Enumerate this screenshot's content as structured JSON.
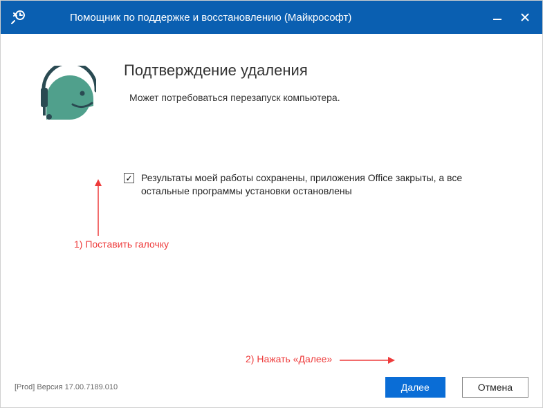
{
  "window": {
    "title": "Помощник по поддержке и восстановлению (Майкрософт)"
  },
  "heading": "Подтверждение удаления",
  "subheading": "Может потребоваться перезапуск компьютера.",
  "checkbox": {
    "checked": true,
    "label": "Результаты моей работы сохранены, приложения Office закрыты, а все остальные программы установки остановлены"
  },
  "annotations": {
    "step1": "1) Поставить галочку",
    "step2": "2) Нажать «Далее»"
  },
  "footer": {
    "version": "[Prod] Версия 17.00.7189.010",
    "next": "Далее",
    "cancel": "Отмена"
  },
  "colors": {
    "titlebar": "#0a5fb1",
    "primary_btn": "#0a6dd6",
    "annotation": "#ee3b3b"
  }
}
